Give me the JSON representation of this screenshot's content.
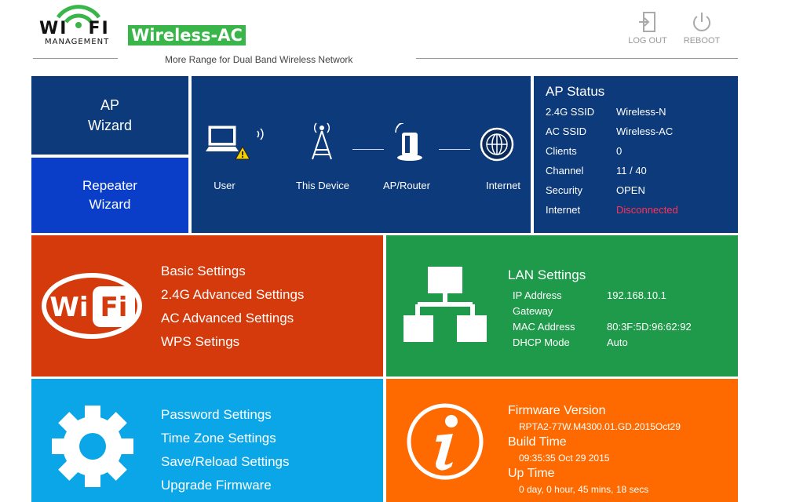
{
  "header": {
    "logo_line1_left": "WI",
    "logo_line1_right": "FI",
    "logo_line2": "MANAGEMENT",
    "brand": "Wireless-AC",
    "tagline": "More Range for Dual Band Wireless Network",
    "logout_label": "LOG OUT",
    "reboot_label": "REBOOT"
  },
  "wizards": {
    "ap_line1": "AP",
    "ap_line2": "Wizard",
    "repeater_line1": "Repeater",
    "repeater_line2": "Wizard"
  },
  "topology": {
    "user": "User",
    "device": "This Device",
    "router": "AP/Router",
    "internet": "Internet"
  },
  "ap_status": {
    "title": "AP Status",
    "rows": [
      {
        "key": "2.4G SSID",
        "value": "Wireless-N"
      },
      {
        "key": "AC SSID",
        "value": "Wireless-AC"
      },
      {
        "key": "Clients",
        "value": "0"
      },
      {
        "key": "Channel",
        "value": "11 / 40"
      },
      {
        "key": "Security",
        "value": "OPEN"
      },
      {
        "key": "Internet",
        "value": "Disconnected"
      }
    ],
    "disconnected_color": "#ff3355"
  },
  "wireless_menu": {
    "logo_text_left": "Wi",
    "logo_text_right": "Fi",
    "items": [
      "Basic Settings",
      "2.4G Advanced Settings",
      "AC Advanced Settings",
      "WPS Setings"
    ]
  },
  "lan": {
    "title": "LAN Settings",
    "rows": [
      {
        "key": "IP Address",
        "value": "192.168.10.1"
      },
      {
        "key": "Gateway",
        "value": ""
      },
      {
        "key": "MAC Address",
        "value": "80:3F:5D:96:62:92"
      },
      {
        "key": "DHCP Mode",
        "value": "Auto"
      }
    ]
  },
  "system_menu": {
    "items": [
      "Password Settings",
      "Time Zone Settings",
      "Save/Reload Settings",
      "Upgrade Firmware"
    ]
  },
  "firmware": {
    "version_label": "Firmware Version",
    "version_value": "RPTA2-77W.M4300.01.GD.2015Oct29",
    "build_label": "Build Time",
    "build_value": "09:35:35 Oct 29 2015",
    "uptime_label": "Up Time",
    "uptime_value": "0 day, 0 hour, 45 mins, 18 secs"
  },
  "colors": {
    "navy": "#0d3a7a",
    "blue": "#0a3ec8",
    "red": "#d43a0b",
    "green": "#1e9a4a",
    "cyan": "#0aa6e8",
    "orange": "#ff6a00",
    "brand_green": "#39b54a"
  }
}
